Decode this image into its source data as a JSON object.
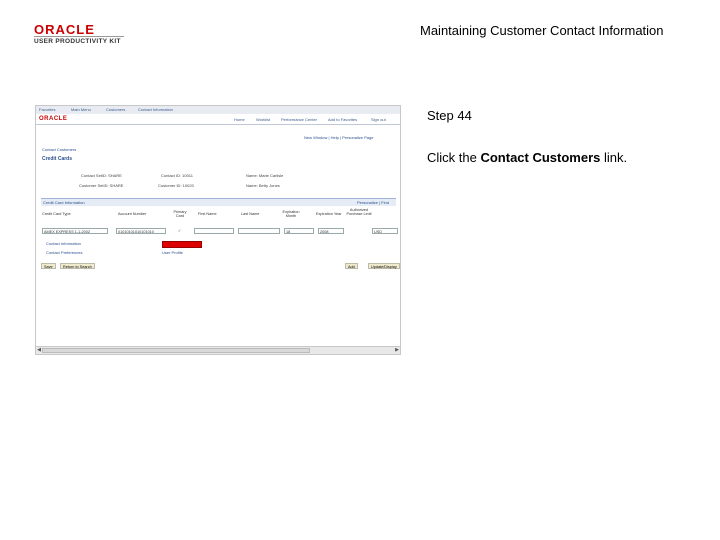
{
  "logo": {
    "word": "ORACLE",
    "sub": "USER PRODUCTIVITY KIT"
  },
  "doc_title": "Maintaining Customer Contact Information",
  "step": "Step 44",
  "instruction": {
    "prefix": "Click the ",
    "link": "Contact Customers",
    "suffix": " link."
  },
  "shot": {
    "topnav": [
      "Favorites",
      "Main Menu",
      "Customers",
      "Contact Information"
    ],
    "brand": "ORACLE",
    "header_links": [
      "Home",
      "Worklist",
      "Performance Center",
      "Add to Favorites",
      "Sign out"
    ],
    "util_links": "New Window | Help | Personalize Page",
    "breadcrumb": "Contact Customers",
    "page_title": "Credit Cards",
    "info_rows": [
      [
        "Contact SetID: SHARE",
        "Contact ID: 10011",
        "Name: Marie Carlisle"
      ],
      [
        "Customer SetID: SHARE",
        "Customer ID: 10020",
        "Name: Betty Jones"
      ]
    ],
    "grid_title": "Credit Card Information",
    "grid_tools": "Personalize | Find",
    "columns": [
      "Credit Card Type",
      "Account Number",
      "Primary Card",
      "First Name",
      "Last Name",
      "Expiration Month",
      "Expiration Year",
      "Authorized Purchase Limit"
    ],
    "row": [
      "AMEX EXPRESS 1-1-2002",
      "01010101010101010",
      "✓",
      "",
      "",
      "18",
      "2008",
      "USD"
    ],
    "links_left": [
      "Contact Information",
      "Contact Preferences"
    ],
    "links_right": [
      "User Profile"
    ],
    "buttons_left": [
      "Save",
      "Return to Search"
    ],
    "buttons_right": [
      "Add",
      "Update/Display"
    ]
  }
}
